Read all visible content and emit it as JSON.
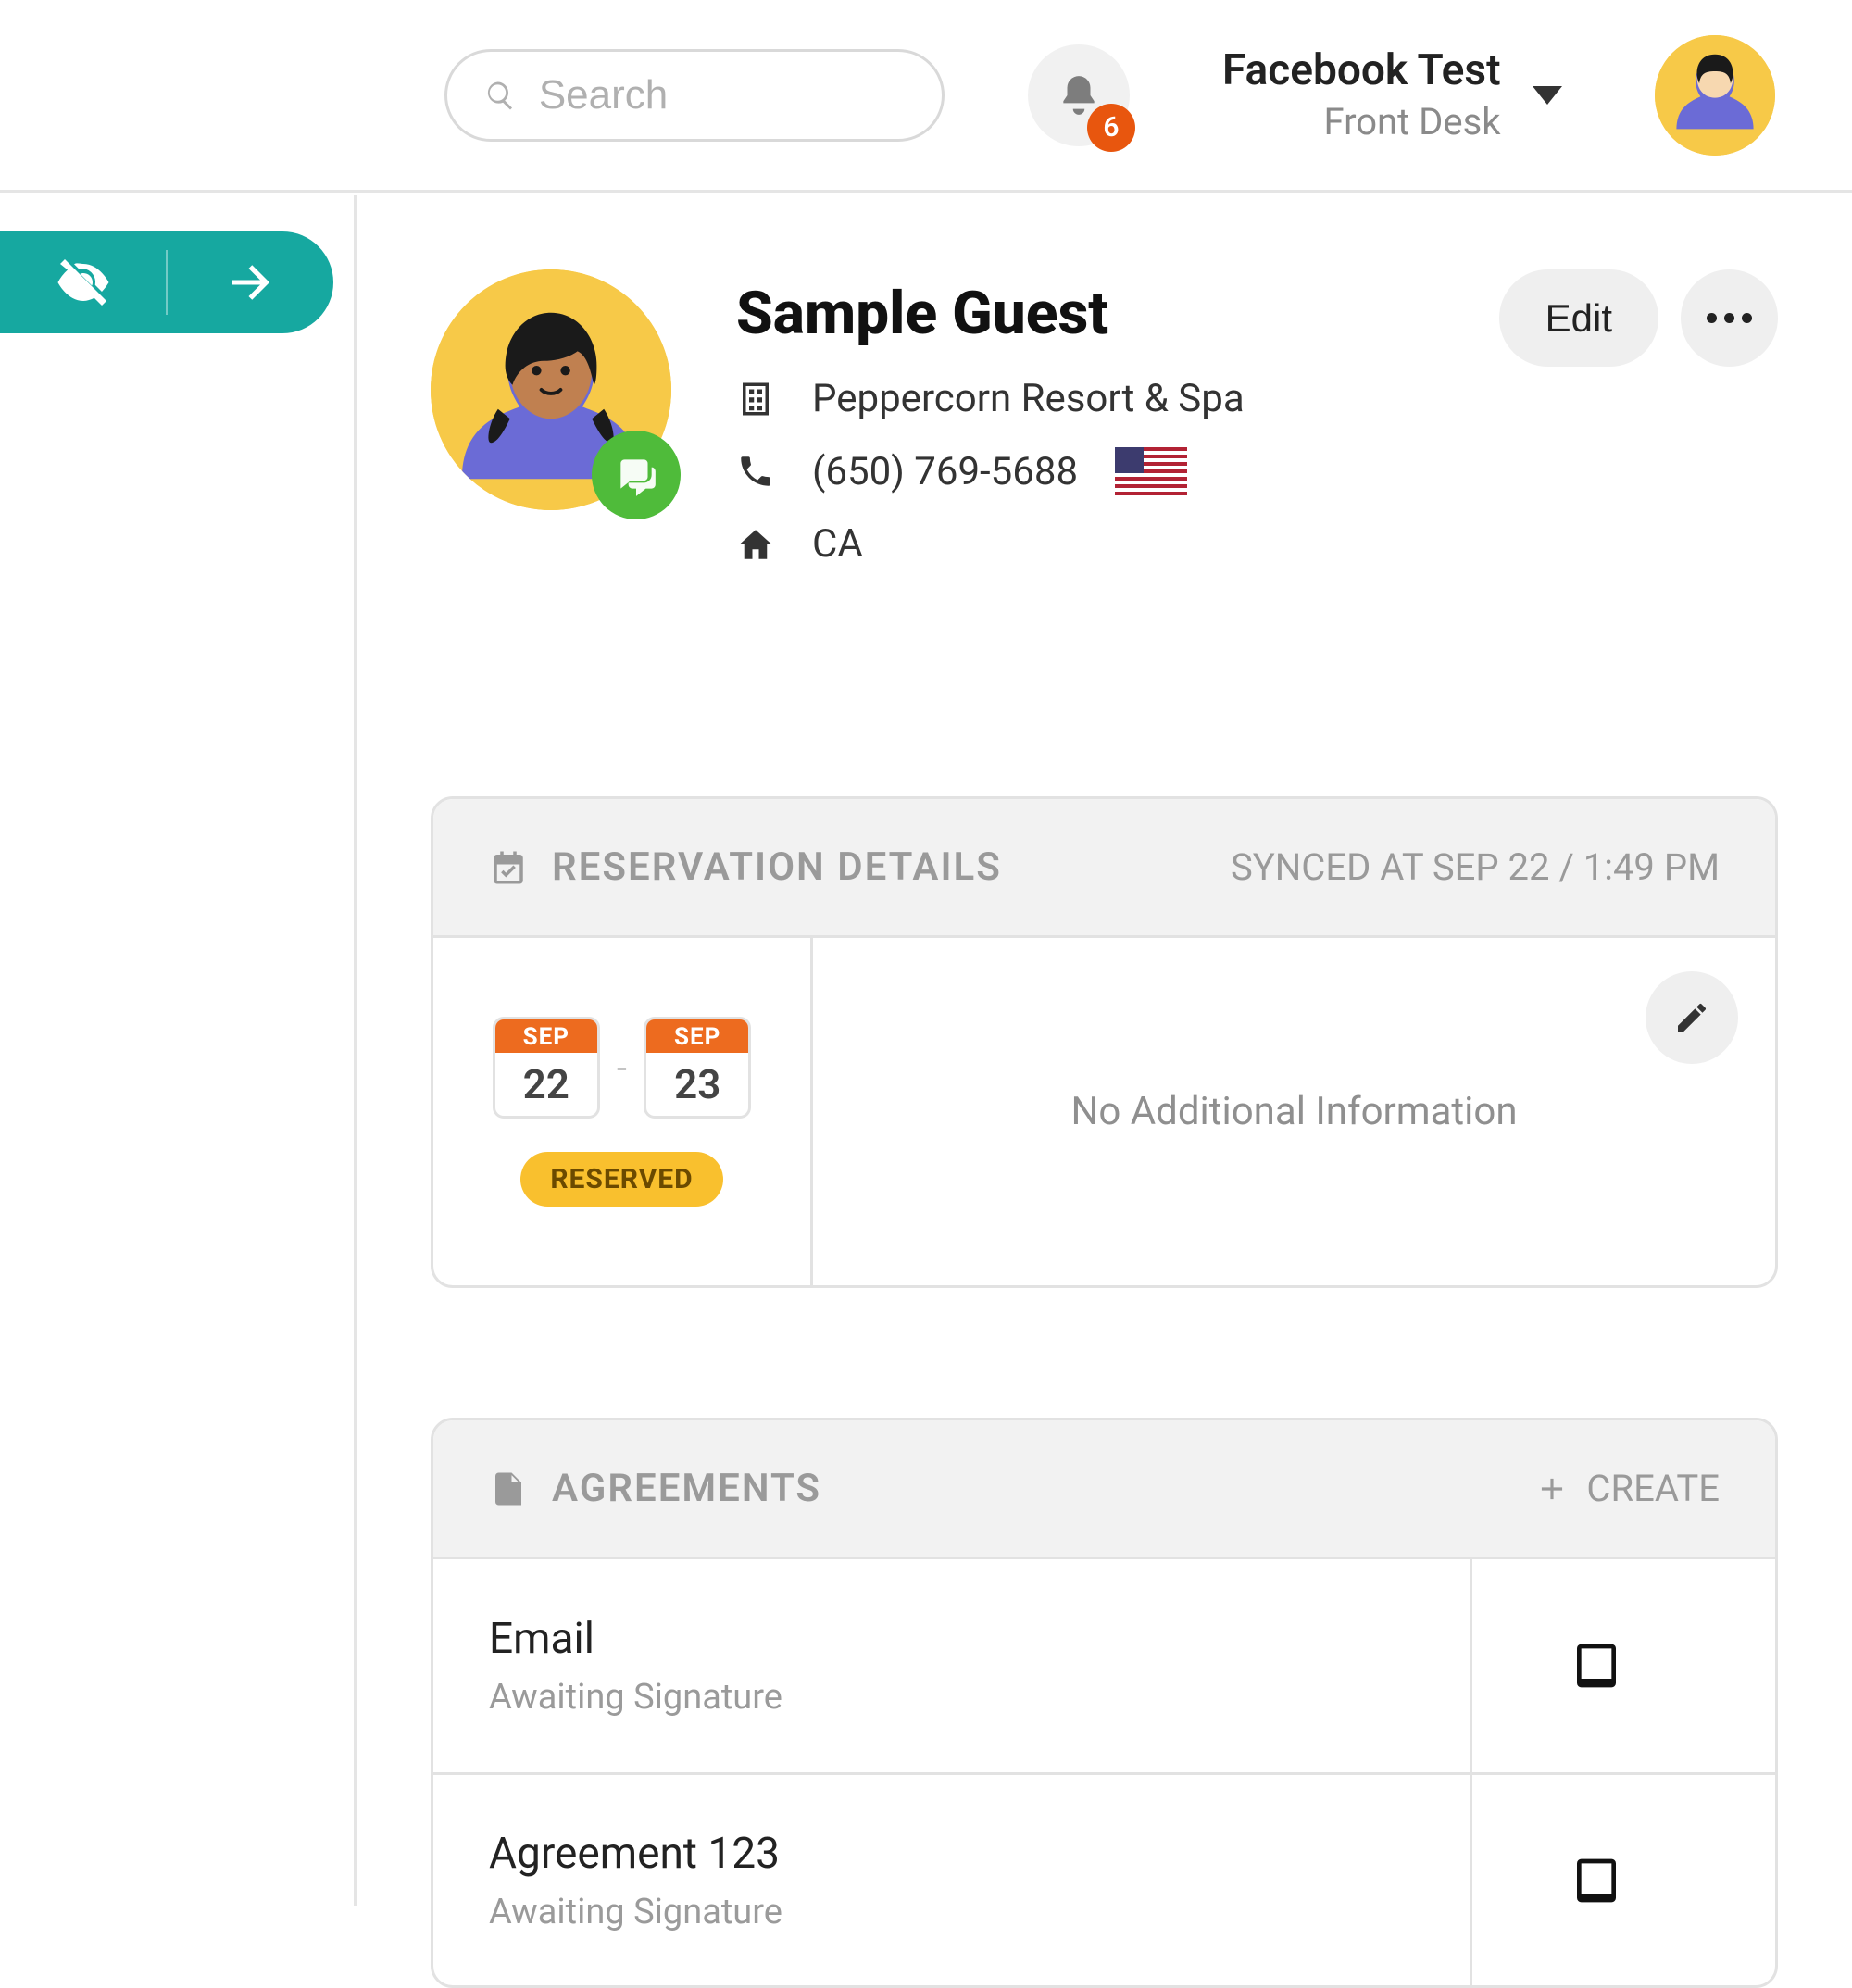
{
  "header": {
    "search_placeholder": "Search",
    "notifications_count": "6",
    "account_title": "Facebook Test",
    "account_subtitle": "Front Desk"
  },
  "profile": {
    "name": "Sample Guest",
    "company": "Peppercorn Resort & Spa",
    "phone": "(650) 769-5688",
    "location": "CA",
    "edit_label": "Edit"
  },
  "reservation": {
    "card_title": "RESERVATION DETAILS",
    "synced_text": "SYNCED AT SEP 22 / 1:49 PM",
    "start_month": "SEP",
    "start_day": "22",
    "end_month": "SEP",
    "end_day": "23",
    "status": "RESERVED",
    "empty_text": "No Additional Information"
  },
  "agreements": {
    "card_title": "AGREEMENTS",
    "create_label": "CREATE",
    "items": [
      {
        "title": "Email",
        "subtitle": "Awaiting Signature"
      },
      {
        "title": "Agreement 123",
        "subtitle": "Awaiting Signature"
      }
    ]
  }
}
